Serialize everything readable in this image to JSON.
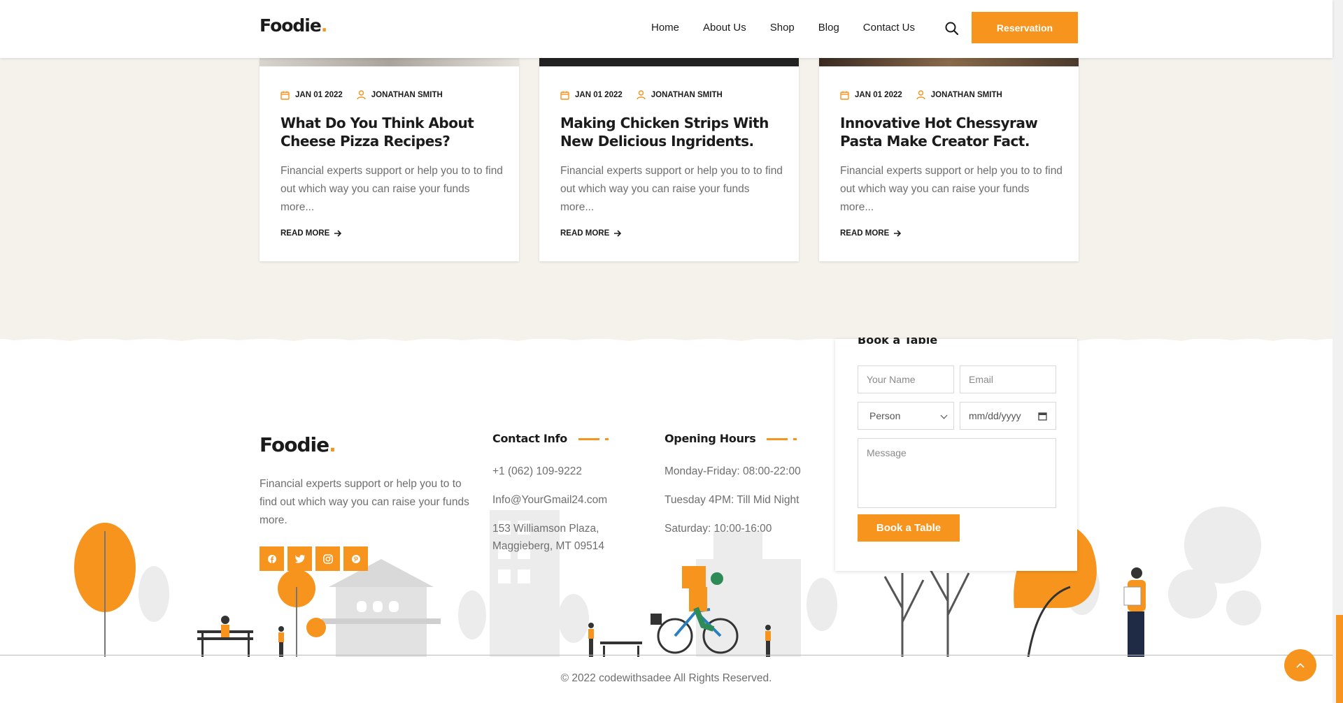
{
  "header": {
    "logo": "Foodie",
    "logo_dot": ".",
    "nav": [
      "Home",
      "About Us",
      "Shop",
      "Blog",
      "Contact Us"
    ],
    "reserve_label": "Reservation"
  },
  "posts": [
    {
      "date": "JAN 01 2022",
      "author": "JONATHAN SMITH",
      "title": "What Do You Think About Cheese Pizza Recipes?",
      "excerpt": "Financial experts support or help you to to find out which way you can raise your funds more...",
      "more": "READ MORE"
    },
    {
      "date": "JAN 01 2022",
      "author": "JONATHAN SMITH",
      "title": "Making Chicken Strips With New Delicious Ingridents.",
      "excerpt": "Financial experts support or help you to to find out which way you can raise your funds more...",
      "more": "READ MORE"
    },
    {
      "date": "JAN 01 2022",
      "author": "JONATHAN SMITH",
      "title": "Innovative Hot Chessyraw Pasta Make Creator Fact.",
      "excerpt": "Financial experts support or help you to to find out which way you can raise your funds more...",
      "more": "READ MORE"
    }
  ],
  "footer": {
    "logo": "Foodie",
    "logo_dot": ".",
    "about": "Financial experts support or help you to to find out which way you can raise your funds more.",
    "socials": [
      "facebook-icon",
      "twitter-icon",
      "instagram-icon",
      "pinterest-icon"
    ],
    "contact": {
      "title": "Contact Info",
      "phone": "+1 (062) 109-9222",
      "email": "Info@YourGmail24.com",
      "address_1": "153 Williamson Plaza,",
      "address_2": "Maggieberg, MT 09514"
    },
    "hours": {
      "title": "Opening Hours",
      "line_1": "Monday-Friday: 08:00-22:00",
      "line_2": "Tuesday 4PM: Till Mid Night",
      "line_3": "Saturday: 10:00-16:00"
    },
    "booking": {
      "title": "Book a Table",
      "name_placeholder": "Your Name",
      "email_placeholder": "Email",
      "person_value": "Person",
      "date_placeholder": "mm/dd/yyyy",
      "message_placeholder": "Message",
      "submit": "Book a Table"
    },
    "copyright": "© 2022 codewithsadee All Rights Reserved."
  },
  "colors": {
    "accent": "#f7941d",
    "dark": "#1b1b1b",
    "text": "#6e6e6e",
    "section_bg": "#f5f2ec"
  }
}
